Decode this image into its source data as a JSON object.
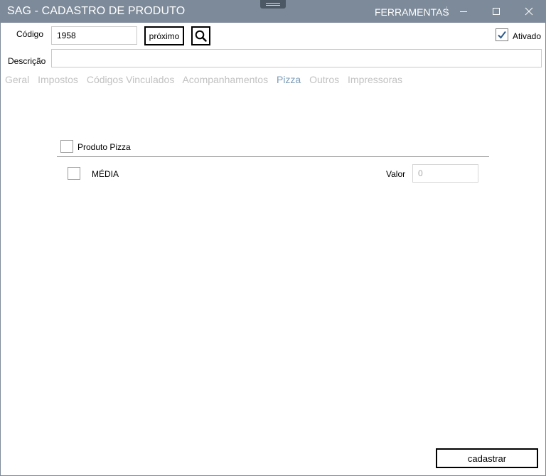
{
  "window": {
    "title": "SAG - CADASTRO DE PRODUTO",
    "menu_label": "FERRAMENTAS"
  },
  "form": {
    "codigo_label": "Código",
    "codigo_value": "1958",
    "proximo_label": "próximo",
    "ativado_label": "Ativado",
    "ativado_checked": true,
    "descricao_label": "Descrição",
    "descricao_value": ""
  },
  "tabs": [
    {
      "label": "Geral",
      "active": false
    },
    {
      "label": "Impostos",
      "active": false
    },
    {
      "label": "Códigos Vinculados",
      "active": false
    },
    {
      "label": "Acompanhamentos",
      "active": false
    },
    {
      "label": "Pizza",
      "active": true
    },
    {
      "label": "Outros",
      "active": false
    },
    {
      "label": "Impressoras",
      "active": false
    }
  ],
  "pizza": {
    "produto_pizza_label": "Produto Pizza",
    "produto_pizza_checked": false,
    "sizes": [
      {
        "label": "MÉDIA",
        "checked": false,
        "valor_label": "Valor",
        "valor_placeholder": "0"
      }
    ]
  },
  "footer": {
    "cadastrar_label": "cadastrar"
  },
  "colors": {
    "titlebar": "#7d8a99",
    "tab_active": "#7d9cb8",
    "tab_inactive": "#c2c2c2",
    "check_accent": "#2b5a8c"
  }
}
